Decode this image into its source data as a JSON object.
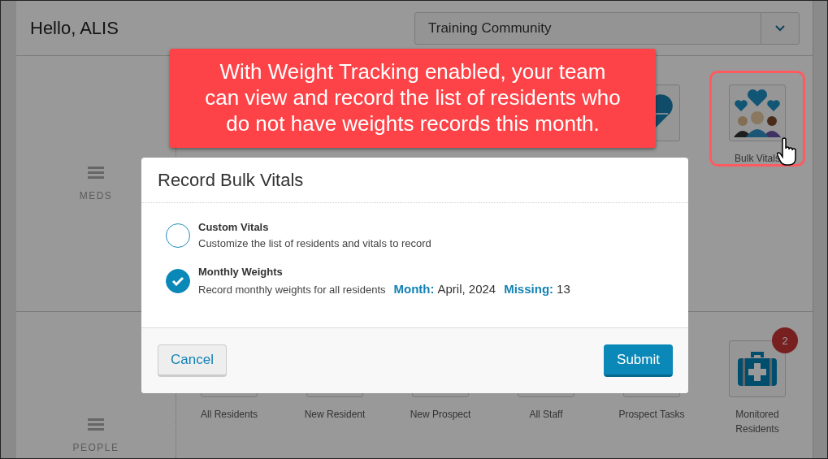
{
  "header": {
    "greeting": "Hello, ALIS",
    "community_select": {
      "value": "Training Community"
    }
  },
  "sections": [
    {
      "name": "MEDS",
      "tiles": [
        {
          "kind": "heart"
        },
        {
          "label": "Bulk Vitals",
          "kind": "vitals",
          "highlighted": true
        }
      ]
    },
    {
      "name": "PEOPLE",
      "tiles": [
        {
          "label": "All Residents",
          "kind": "plain"
        },
        {
          "label": "New Resident",
          "kind": "plain"
        },
        {
          "label": "New Prospect",
          "kind": "plain"
        },
        {
          "label": "All Staff",
          "kind": "plain"
        },
        {
          "label": "Prospect Tasks",
          "kind": "plain"
        },
        {
          "label": "Monitored Residents",
          "kind": "medkit",
          "badge": "2"
        }
      ]
    }
  ],
  "callout": {
    "text": "With Weight Tracking enabled, your team can view and record the list of residents who do not have weights records this month."
  },
  "modal": {
    "title": "Record Bulk Vitals",
    "options": [
      {
        "title": "Custom Vitals",
        "description": "Customize the list of residents and vitals to record",
        "selected": false
      },
      {
        "title": "Monthly Weights",
        "description": "Record monthly weights for all residents",
        "selected": true,
        "details": [
          {
            "label": "Month:",
            "value": "April, 2024"
          },
          {
            "label": "Missing:",
            "value": "13"
          }
        ]
      }
    ],
    "buttons": [
      {
        "label": "Cancel",
        "kind": "secondary"
      },
      {
        "label": "Submit",
        "kind": "primary"
      }
    ]
  }
}
